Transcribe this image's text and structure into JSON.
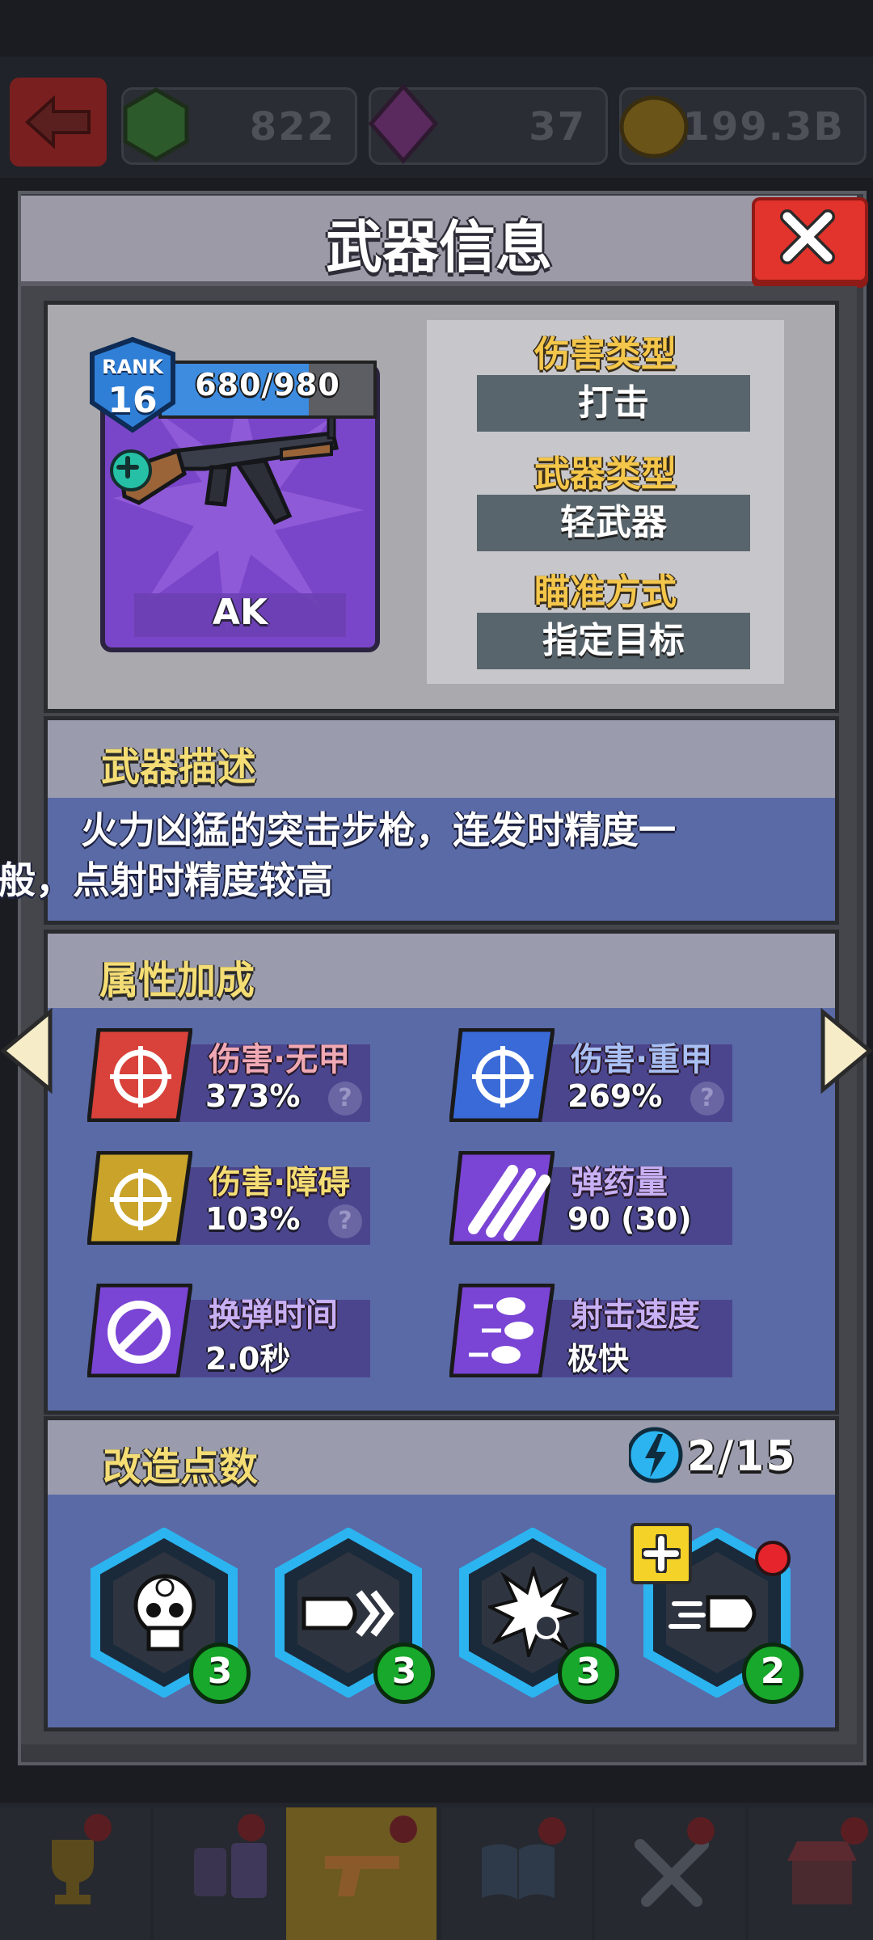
{
  "currency": {
    "green": "822",
    "purple": "37",
    "gold": "199.3B"
  },
  "dialog": {
    "title": "武器信息"
  },
  "weapon": {
    "rank_label": "RANK",
    "rank": "16",
    "xp": "680/980",
    "xp_progress": 0.694,
    "name": "AK"
  },
  "types": [
    {
      "label": "伤害类型",
      "value": "打击"
    },
    {
      "label": "武器类型",
      "value": "轻武器"
    },
    {
      "label": "瞄准方式",
      "value": "指定目标"
    }
  ],
  "description": {
    "title": "武器描述",
    "text": "火力凶猛的突击步枪，连发时精度一般，点射时精度较高"
  },
  "attributes": {
    "title": "属性加成",
    "items": [
      {
        "name": "伤害·无甲",
        "value": "373%",
        "help": "?",
        "icon": "unarmored-target-icon",
        "color": "#d8423a"
      },
      {
        "name": "伤害·重甲",
        "value": "269%",
        "help": "?",
        "icon": "armored-target-icon",
        "color": "#3a6ad8"
      },
      {
        "name": "伤害·障碍",
        "value": "103%",
        "help": "?",
        "icon": "obstacle-target-icon",
        "color": "#c9a32a"
      },
      {
        "name": "弹药量",
        "value": "90 (30)",
        "icon": "ammo-icon",
        "color": "#7a44d4"
      },
      {
        "name": "换弹时间",
        "value": "2.0秒",
        "icon": "reload-icon",
        "color": "#7a44d4"
      },
      {
        "name": "射击速度",
        "value": "极快",
        "icon": "fire-rate-icon",
        "color": "#7a44d4"
      }
    ]
  },
  "modify": {
    "title": "改造点数",
    "points": "2/15",
    "slots": [
      {
        "icon": "skull-target-icon",
        "level": "3"
      },
      {
        "icon": "bullet-chevron-icon",
        "level": "3"
      },
      {
        "icon": "explosion-icon",
        "level": "3"
      },
      {
        "icon": "speed-bullet-icon",
        "level": "2"
      }
    ]
  },
  "colors": {
    "accent_gold": "#f4c64a",
    "close_red": "#e2332c",
    "panel_blue": "#5a6aa6"
  }
}
